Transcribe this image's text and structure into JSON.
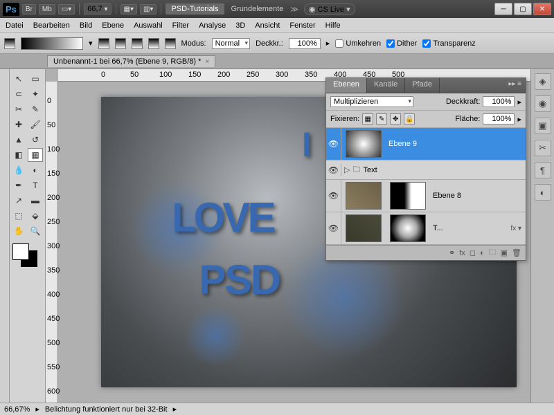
{
  "titlebar": {
    "app": "Ps",
    "br": "Br",
    "mb": "Mb",
    "zoom": "66,7",
    "breadcrumb1": "PSD-Tutorials",
    "breadcrumb2": "Grundelemente",
    "cslive": "CS Live"
  },
  "menu": [
    "Datei",
    "Bearbeiten",
    "Bild",
    "Ebene",
    "Auswahl",
    "Filter",
    "Analyse",
    "3D",
    "Ansicht",
    "Fenster",
    "Hilfe"
  ],
  "options": {
    "modus_label": "Modus:",
    "modus_value": "Normal",
    "deckk_label": "Deckkr.:",
    "deckk_value": "100%",
    "umkehren": "Umkehren",
    "dither": "Dither",
    "transparenz": "Transparenz"
  },
  "doctab": "Unbenannt-1 bei 66,7% (Ebene 9, RGB/8) *",
  "ruler_h": [
    "0",
    "50",
    "100",
    "150",
    "200",
    "250",
    "300",
    "350",
    "400",
    "450",
    "500"
  ],
  "ruler_v": [
    "0",
    "50",
    "100",
    "150",
    "200",
    "250",
    "300",
    "350",
    "400",
    "450",
    "500",
    "550",
    "600"
  ],
  "canvas_text": {
    "l1": "I",
    "l2": "LOVE",
    "l3": "PSD"
  },
  "panel": {
    "tabs": [
      "Ebenen",
      "Kanäle",
      "Pfade"
    ],
    "blend": "Multiplizieren",
    "deckk_label": "Deckkraft:",
    "deckk": "100%",
    "fix_label": "Fixieren:",
    "flache_label": "Fläche:",
    "flache": "100%",
    "layers": [
      {
        "name": "Ebene 9",
        "sel": true
      },
      {
        "name": "Text",
        "group": true
      },
      {
        "name": "Ebene 8"
      },
      {
        "name": "T..."
      }
    ]
  },
  "status": {
    "zoom": "66,67%",
    "msg": "Belichtung funktioniert nur bei 32-Bit"
  }
}
